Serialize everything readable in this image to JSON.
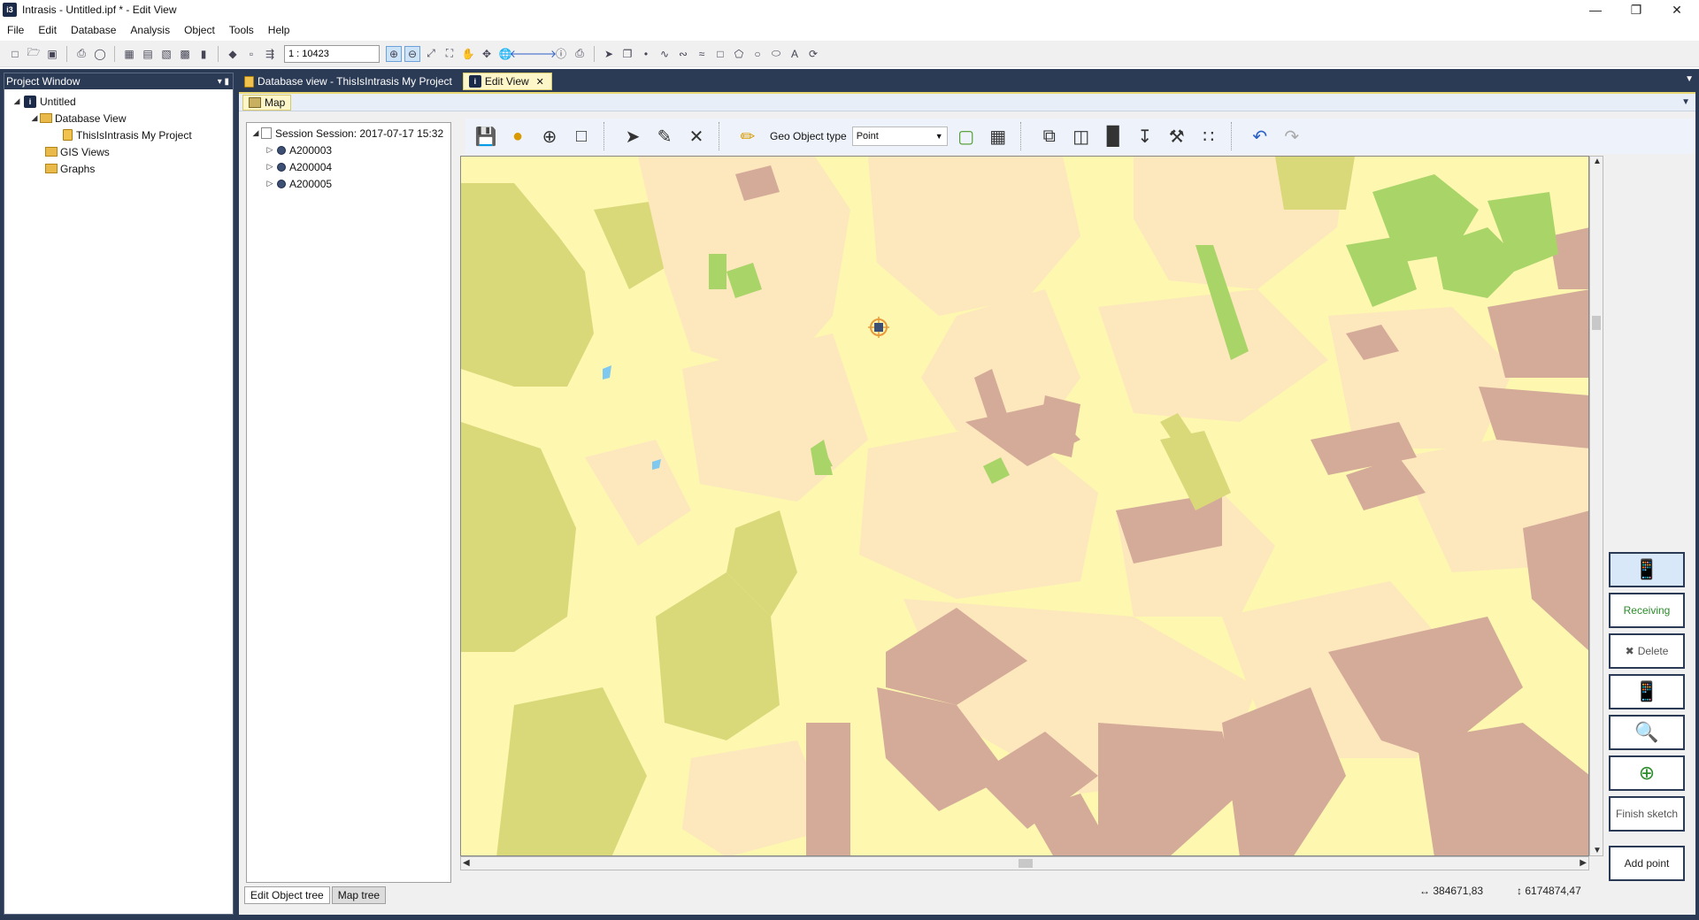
{
  "window": {
    "title": "Intrasis - Untitled.ipf * - Edit View",
    "app_icon": "i3"
  },
  "menu": [
    "File",
    "Edit",
    "Database",
    "Analysis",
    "Object",
    "Tools",
    "Help"
  ],
  "toolbar": {
    "scale_value": "1 : 10423"
  },
  "project_window": {
    "header": "Project Window",
    "tree": {
      "root": "Untitled",
      "database_view": "Database View",
      "project": "ThisIsIntrasis My Project",
      "gis_views": "GIS Views",
      "graphs": "Graphs"
    }
  },
  "doc_tabs": [
    {
      "label": "Database view - ThisIsIntrasis My Project"
    },
    {
      "label": "Edit View"
    }
  ],
  "subtab": {
    "map_label": "Map"
  },
  "object_tree": {
    "session": "Session Session: 2017-07-17 15:32",
    "items": [
      "A200003",
      "A200004",
      "A200005"
    ],
    "tabs": [
      "Edit Object tree",
      "Map tree"
    ]
  },
  "map_toolbar": {
    "geo_label": "Geo Object type",
    "geo_value": "Point"
  },
  "right_panel": {
    "receiving": "Receiving",
    "delete": "Delete",
    "finish_sketch": "Finish sketch",
    "add_point": "Add point"
  },
  "status": {
    "x_coord": "384671,83",
    "y_coord": "6174874,47"
  },
  "colors": {
    "frame": "#2b3a55",
    "map_base": "#fdf7b0",
    "map_light": "#f3f9a7",
    "map_peach": "#fde7bd",
    "map_olive": "#d9d97a",
    "map_building": "#d4aa98",
    "map_green": "#a8d468"
  }
}
